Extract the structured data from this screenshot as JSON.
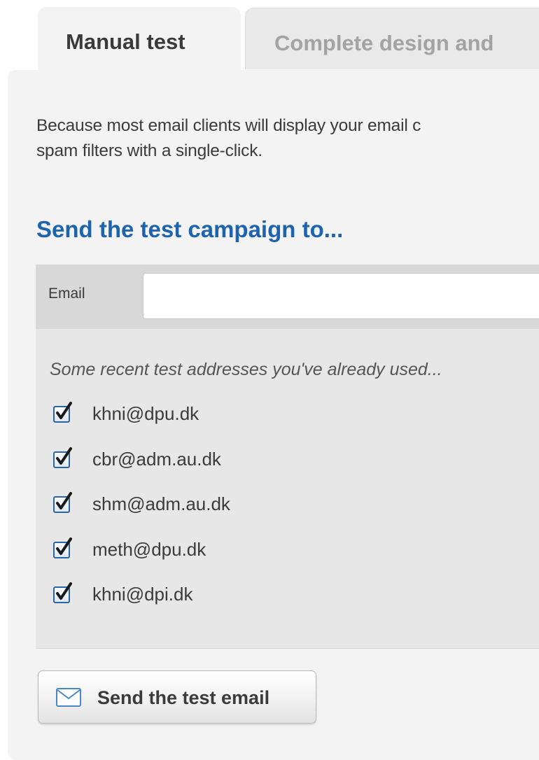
{
  "tabs": [
    {
      "label": "Manual test",
      "active": true
    },
    {
      "label": "Complete design and",
      "active": false
    }
  ],
  "intro_text": "Because most email clients will display your email c\nspam filters with a single-click.",
  "section_heading": "Send the test campaign to...",
  "email_field": {
    "label": "Email",
    "value": "",
    "placeholder": ""
  },
  "recent": {
    "title": "Some recent test addresses you've already used...",
    "items": [
      {
        "email": "khni@dpu.dk",
        "checked": true
      },
      {
        "email": "cbr@adm.au.dk",
        "checked": true
      },
      {
        "email": "shm@adm.au.dk",
        "checked": true
      },
      {
        "email": "meth@dpu.dk",
        "checked": true
      },
      {
        "email": "khni@dpi.dk",
        "checked": true
      }
    ]
  },
  "send_button": {
    "label": "Send the test email",
    "icon": "envelope-icon"
  },
  "colors": {
    "heading_blue": "#1d63ad",
    "panel_bg": "#f3f3f3",
    "email_row_bg": "#d8d8d8",
    "recent_bg": "#e7e7e7",
    "checkbox_border": "#2c64a8",
    "checkmark": "#1a1a1a",
    "text": "#3b3b3b"
  }
}
